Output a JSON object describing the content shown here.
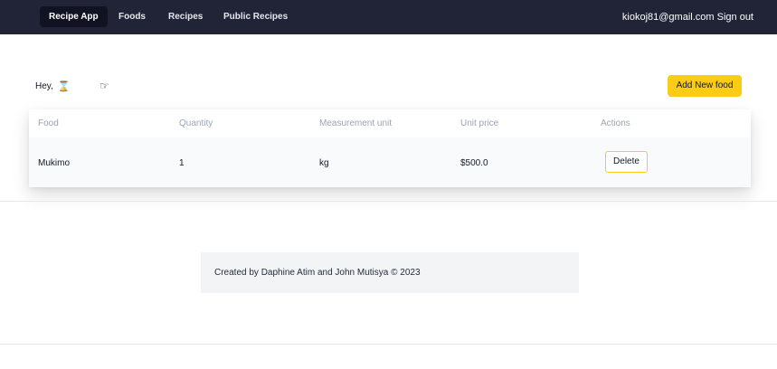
{
  "nav": {
    "brand": "Recipe App",
    "links": [
      "Foods",
      "Recipes",
      "Public Recipes"
    ],
    "user_email": "kiokoj81@gmail.com",
    "sign_out": "Sign out"
  },
  "greeting": {
    "text": "Hey,",
    "hourglass_glyph": "⌛",
    "pointing_glyph": "☞"
  },
  "add_button": "Add New food",
  "table": {
    "headers": [
      "Food",
      "Quantity",
      "Measurement unit",
      "Unit price",
      "Actions"
    ],
    "rows": [
      {
        "food": "Mukimo",
        "quantity": "1",
        "unit": "kg",
        "price": "$500.0",
        "action": "Delete"
      }
    ]
  },
  "footer": {
    "text": "Created by Daphine Atim and John Mutisya © 2023"
  },
  "colors": {
    "navbar_bg": "#212437",
    "accent_yellow": "#facc15"
  }
}
